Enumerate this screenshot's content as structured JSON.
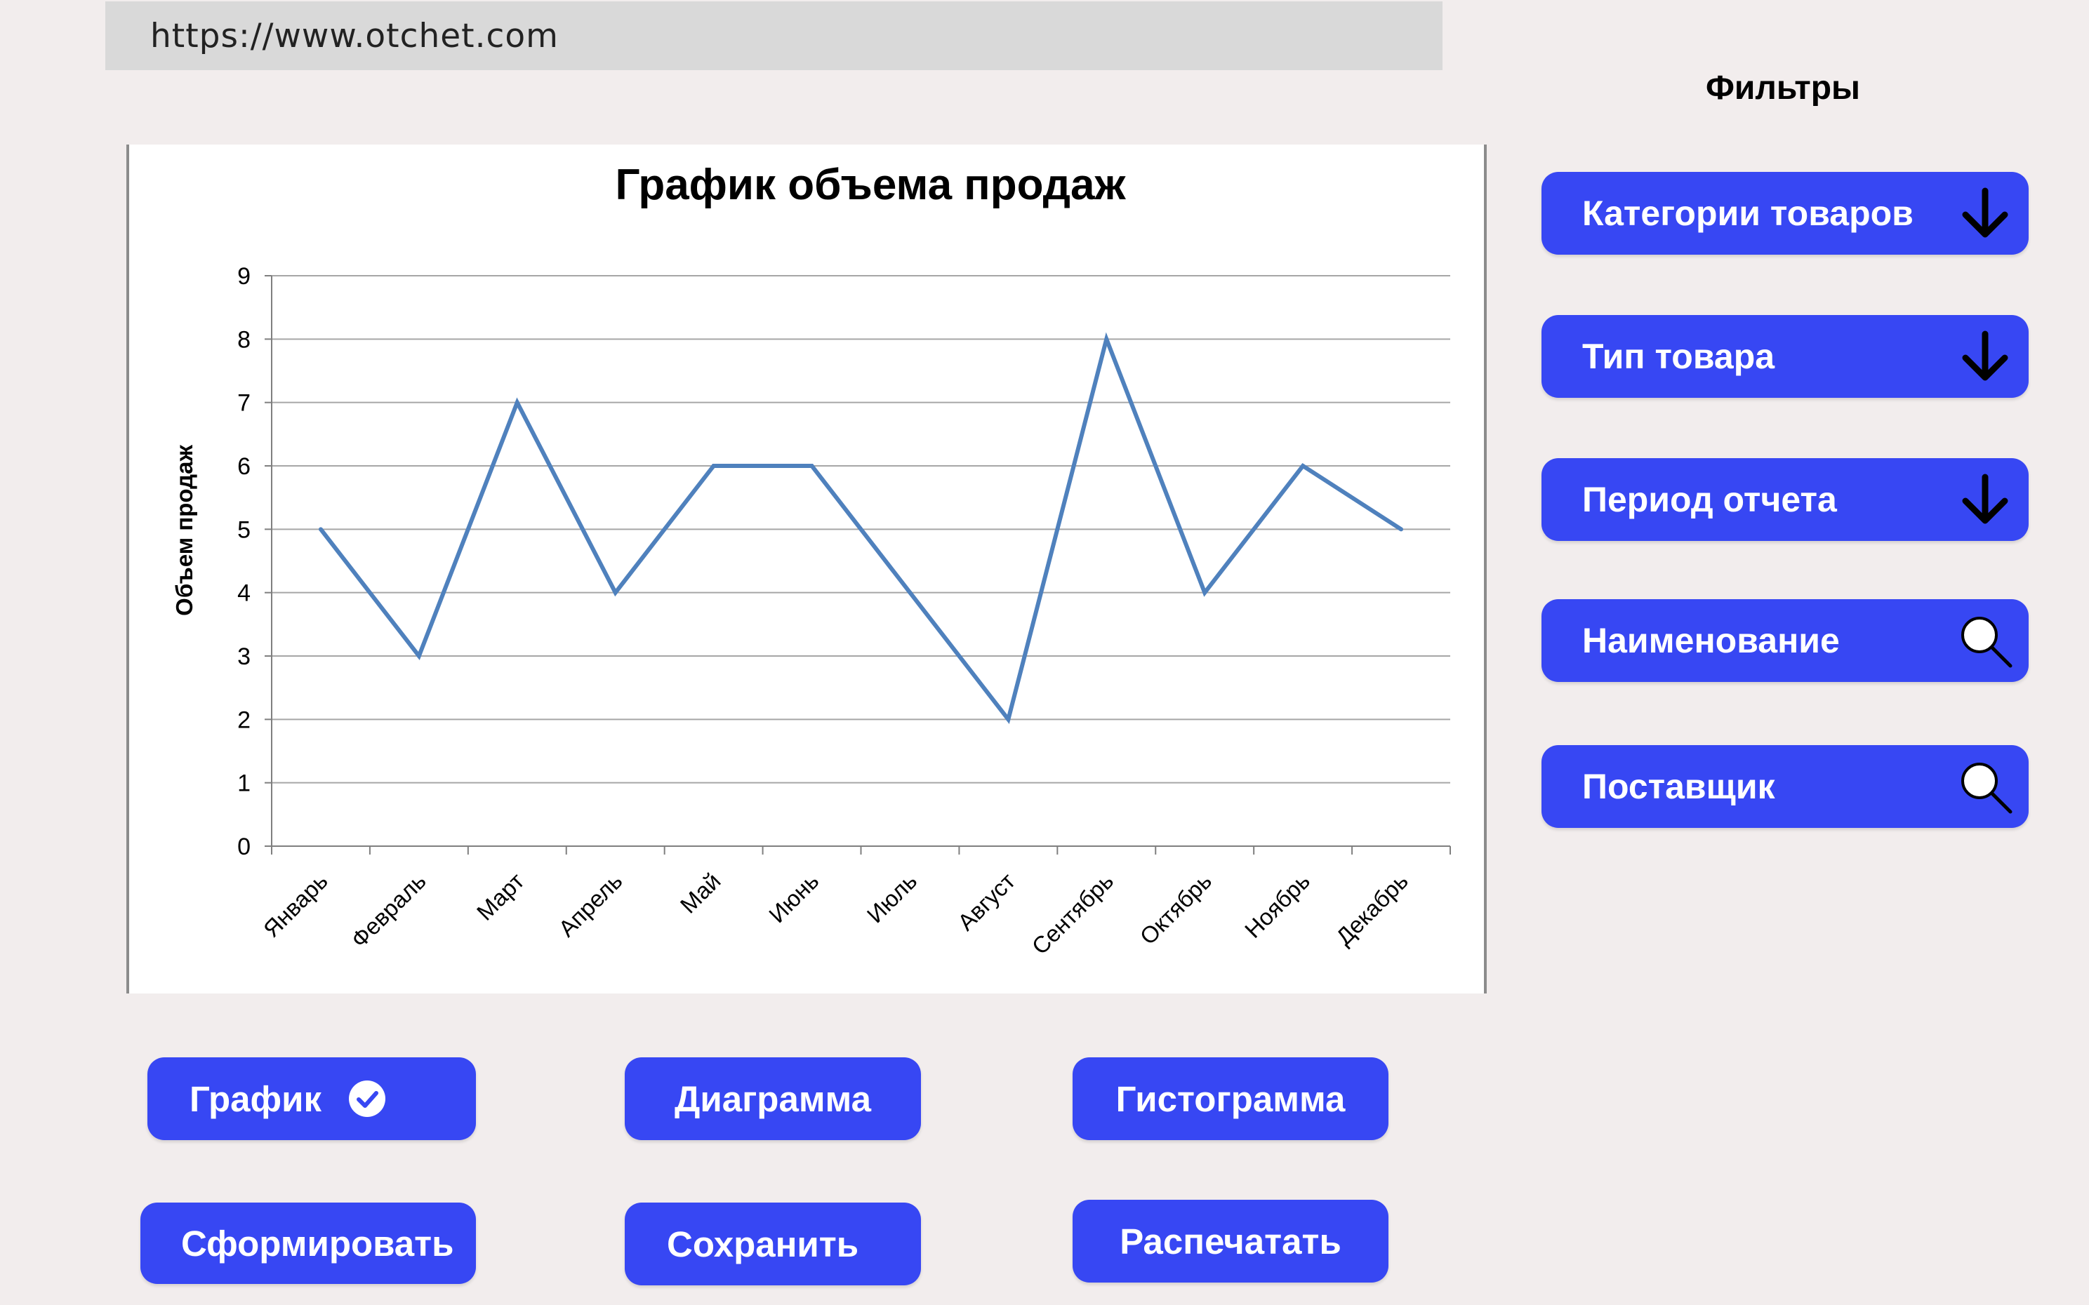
{
  "browser": {
    "url": "https://www.otchet.com"
  },
  "filters": {
    "title": "Фильтры",
    "items": [
      {
        "label": "Категории товаров",
        "icon": "arrow-down-icon"
      },
      {
        "label": "Тип товара",
        "icon": "arrow-down-icon"
      },
      {
        "label": "Период отчета",
        "icon": "arrow-down-icon"
      },
      {
        "label": "Наименование",
        "icon": "search-icon"
      },
      {
        "label": "Поставщик",
        "icon": "search-icon"
      }
    ]
  },
  "chart_types": {
    "graph_label": "График",
    "graph_selected": true,
    "diagram_label": "Диаграмма",
    "histogram_label": "Гистограмма"
  },
  "actions": {
    "generate_label": "Сформировать",
    "save_label": "Сохранить",
    "print_label": "Распечатать"
  },
  "colors": {
    "accent": "#3747f3",
    "line": "#4f81bd",
    "background": "#f2eded"
  },
  "chart_data": {
    "type": "line",
    "title": "График объема продаж",
    "xlabel": "",
    "ylabel": "Объем продаж",
    "categories": [
      "Январь",
      "Февраль",
      "Март",
      "Апрель",
      "Май",
      "Июнь",
      "Июль",
      "Август",
      "Сентябрь",
      "Октябрь",
      "Ноябрь",
      "Декабрь"
    ],
    "values": [
      5,
      3,
      7,
      4,
      6,
      6,
      4,
      2,
      8,
      4,
      6,
      5
    ],
    "ylim": [
      0,
      9
    ],
    "yticks": [
      0,
      1,
      2,
      3,
      4,
      5,
      6,
      7,
      8,
      9
    ],
    "grid": true,
    "legend": "none"
  }
}
